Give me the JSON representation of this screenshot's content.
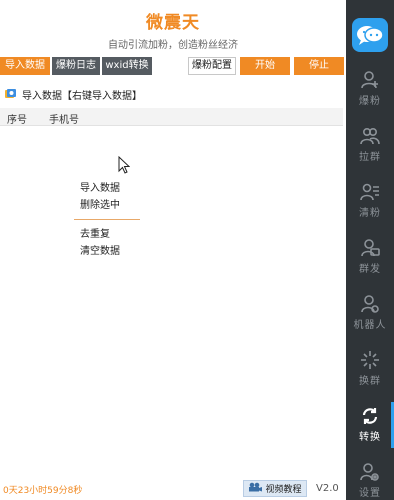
{
  "header": {
    "title": "微震天",
    "subtitle": "自动引流加粉，创造粉丝经济"
  },
  "tabs": [
    {
      "label": "导入数据"
    },
    {
      "label": "爆粉日志"
    },
    {
      "label": "wxid转换"
    },
    {
      "label": "爆粉配置"
    },
    {
      "label": "开始"
    },
    {
      "label": "停止"
    }
  ],
  "section": {
    "heading": "导入数据【右键导入数据】"
  },
  "table": {
    "columns": [
      "序号",
      "手机号"
    ],
    "rows": []
  },
  "context_menu": {
    "items": [
      "导入数据",
      "删除选中",
      "去重复",
      "清空数据"
    ]
  },
  "status": {
    "timer": "0天23小时59分8秒",
    "video_button": "视频教程",
    "version": "V2.0"
  },
  "sidebar": {
    "items": [
      {
        "label": "爆粉",
        "icon": "user-plus-icon",
        "active": false
      },
      {
        "label": "拉群",
        "icon": "group-icon",
        "active": false
      },
      {
        "label": "清粉",
        "icon": "user-list-icon",
        "active": false
      },
      {
        "label": "群发",
        "icon": "user-message-icon",
        "active": false
      },
      {
        "label": "机器人",
        "icon": "user-robot-icon",
        "active": false
      },
      {
        "label": "换群",
        "icon": "sparkle-icon",
        "active": false
      },
      {
        "label": "转换",
        "icon": "convert-icon",
        "active": true
      },
      {
        "label": "设置",
        "icon": "user-settings-icon",
        "active": false
      }
    ]
  },
  "colors": {
    "accent": "#f08a24",
    "sidebar_bg": "#2f3438",
    "highlight": "#2ea0ee"
  }
}
